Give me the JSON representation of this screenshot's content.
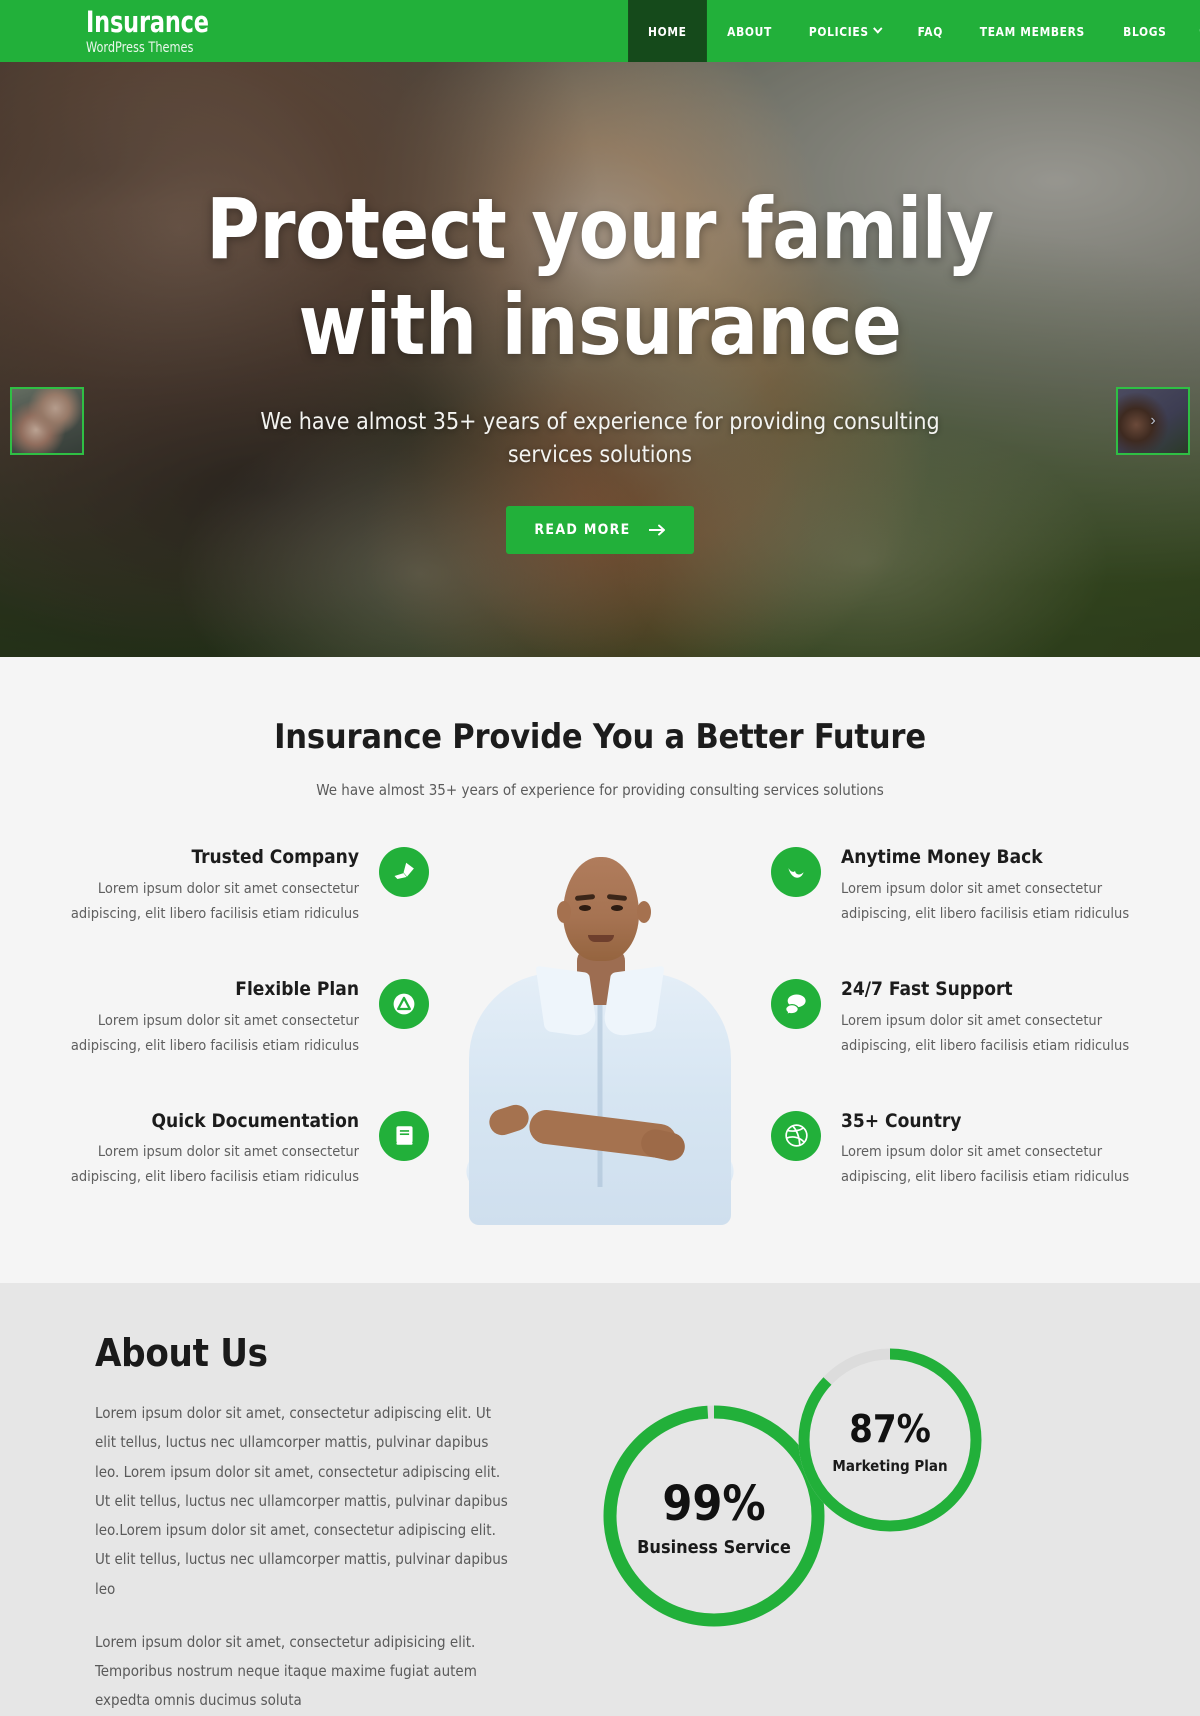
{
  "theme": {
    "accent": "#22b03a",
    "accent_dark": "#154a1b",
    "text_dark": "#1c1c1c",
    "section_bg_light": "#f5f5f5",
    "section_bg_gray": "#e6e6e6"
  },
  "header": {
    "brand_title": "Insurance",
    "brand_tagline": "WordPress Themes",
    "nav": [
      {
        "label": "HOME",
        "active": true,
        "has_caret": false
      },
      {
        "label": "ABOUT",
        "active": false,
        "has_caret": false
      },
      {
        "label": "POLICIES",
        "active": false,
        "has_caret": true
      },
      {
        "label": "FAQ",
        "active": false,
        "has_caret": false
      },
      {
        "label": "TEAM MEMBERS",
        "active": false,
        "has_caret": false
      },
      {
        "label": "BLOGS",
        "active": false,
        "has_caret": false
      }
    ],
    "icons": [
      {
        "name": "search-icon"
      },
      {
        "name": "grid-menu-icon"
      }
    ]
  },
  "hero": {
    "title_line1": "Protect your family",
    "title_line2": "with insurance",
    "subtitle": "We have almost 35+ years of experience for providing consulting services solutions",
    "button_label": "READ MORE",
    "thumb_left_alt": "father lifting child slide thumbnail",
    "thumb_right_alt": "smiling man slide thumbnail",
    "next_arrow": "›"
  },
  "features": {
    "title": "Insurance Provide You a Better Future",
    "subtitle": "We have almost 35+ years of experience for providing consulting services solutions",
    "body_text": "Lorem ipsum dolor sit amet consectetur adipiscing, elit libero facilisis etiam ridiculus",
    "left": [
      {
        "title": "Trusted Company",
        "text": "Lorem ipsum dolor sit amet consectetur adipiscing, elit libero facilisis etiam ridiculus",
        "icon": "black-tie-icon"
      },
      {
        "title": "Flexible Plan",
        "text": "Lorem ipsum dolor sit amet consectetur adipiscing, elit libero facilisis etiam ridiculus",
        "icon": "arrow-circle-up-icon"
      },
      {
        "title": "Quick Documentation",
        "text": "Lorem ipsum dolor sit amet consectetur adipiscing, elit libero facilisis etiam ridiculus",
        "icon": "book-icon"
      }
    ],
    "right": [
      {
        "title": "Anytime Money Back",
        "text": "Lorem ipsum dolor sit amet consectetur adipiscing, elit libero facilisis etiam ridiculus",
        "icon": "envira-leaf-icon"
      },
      {
        "title": "24/7 Fast Support",
        "text": "Lorem ipsum dolor sit amet consectetur adipiscing, elit libero facilisis etiam ridiculus",
        "icon": "comments-icon"
      },
      {
        "title": "35+ Country",
        "text": "Lorem ipsum dolor sit amet consectetur adipiscing, elit libero facilisis etiam ridiculus",
        "icon": "dribbble-icon"
      }
    ],
    "portrait_alt": "businessman with arms crossed"
  },
  "about": {
    "title": "About Us",
    "paragraph1": "Lorem ipsum dolor sit amet, consectetur adipiscing elit. Ut elit tellus, luctus nec ullamcorper mattis, pulvinar dapibus leo. Lorem ipsum dolor sit amet, consectetur adipiscing elit. Ut elit tellus, luctus nec ullamcorper mattis, pulvinar dapibus leo.Lorem ipsum dolor sit amet, consectetur adipiscing elit. Ut elit tellus, luctus nec ullamcorper mattis, pulvinar dapibus leo",
    "paragraph2": "Lorem ipsum dolor sit amet, consectetur adipisicing elit. Temporibus nostrum neque itaque maxime fugiat autem expedta omnis ducimus soluta",
    "circles": [
      {
        "percent": "99%",
        "value": 99,
        "label": "Business Service"
      },
      {
        "percent": "87%",
        "value": 87,
        "label": "Marketing Plan"
      }
    ]
  },
  "chart_data": {
    "type": "pie",
    "title": "About Us skill progress circles",
    "series": [
      {
        "name": "Business Service",
        "value": 99,
        "unit": "%",
        "color": "#22b03a",
        "track_color": "#dcdcdc"
      },
      {
        "name": "Marketing Plan",
        "value": 87,
        "unit": "%",
        "color": "#22b03a",
        "track_color": "#dcdcdc"
      }
    ],
    "ylim": [
      0,
      100
    ]
  }
}
